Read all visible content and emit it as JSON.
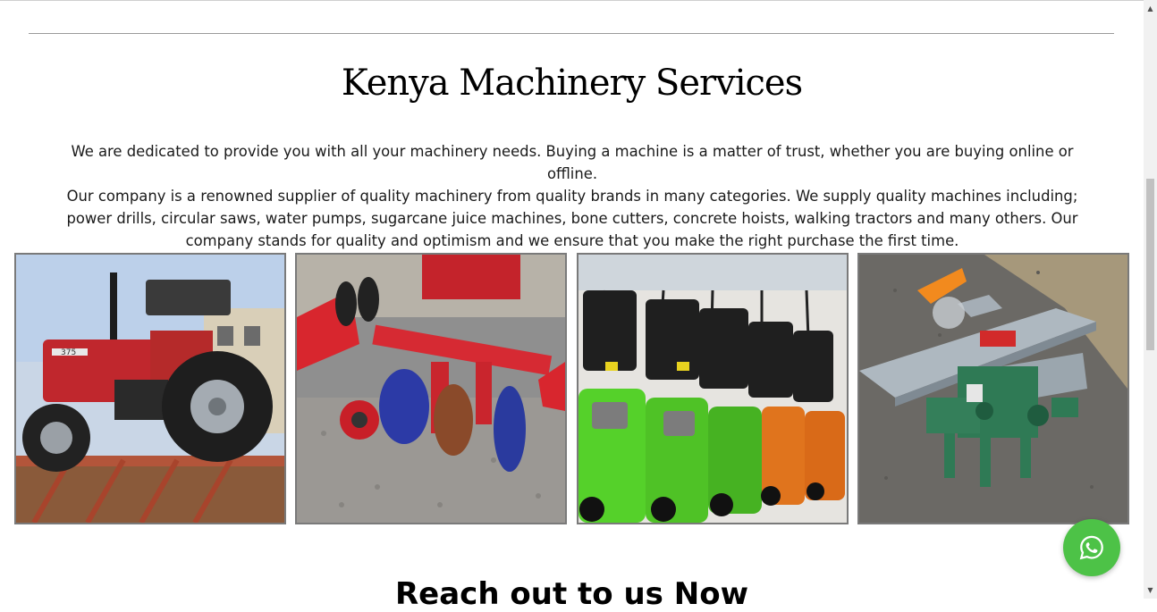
{
  "section": {
    "title": "Kenya Machinery Services",
    "intro_lines": [
      "We are dedicated to provide you with all your machinery needs. Buying a machine is a matter of trust, whether you are buying online or offline.",
      "Our company is a renowned supplier of quality machinery from quality brands in many categories. We supply quality machines including;",
      "power drills, circular saws, water pumps, sugarcane juice machines, bone cutters, concrete hoists, walking tractors and many others. Our",
      "company stands for quality and optimism and we ensure that you make the right purchase the first time."
    ]
  },
  "gallery": {
    "images": [
      {
        "name": "tractor-image",
        "icon": "tractor-photo"
      },
      {
        "name": "plough-image",
        "icon": "disc-plough-photo"
      },
      {
        "name": "lawn-mowers-image",
        "icon": "lawn-mowers-photo"
      },
      {
        "name": "woodworking-machine-image",
        "icon": "planer-machine-photo"
      }
    ],
    "tractor_badge": "375"
  },
  "next_section": {
    "title": "Reach out to us Now"
  },
  "whatsapp": {
    "icon": "whatsapp-icon",
    "color": "#4dc247"
  },
  "colors": {
    "divider": "#9a9a9a",
    "image_border": "#7a7a7a"
  }
}
